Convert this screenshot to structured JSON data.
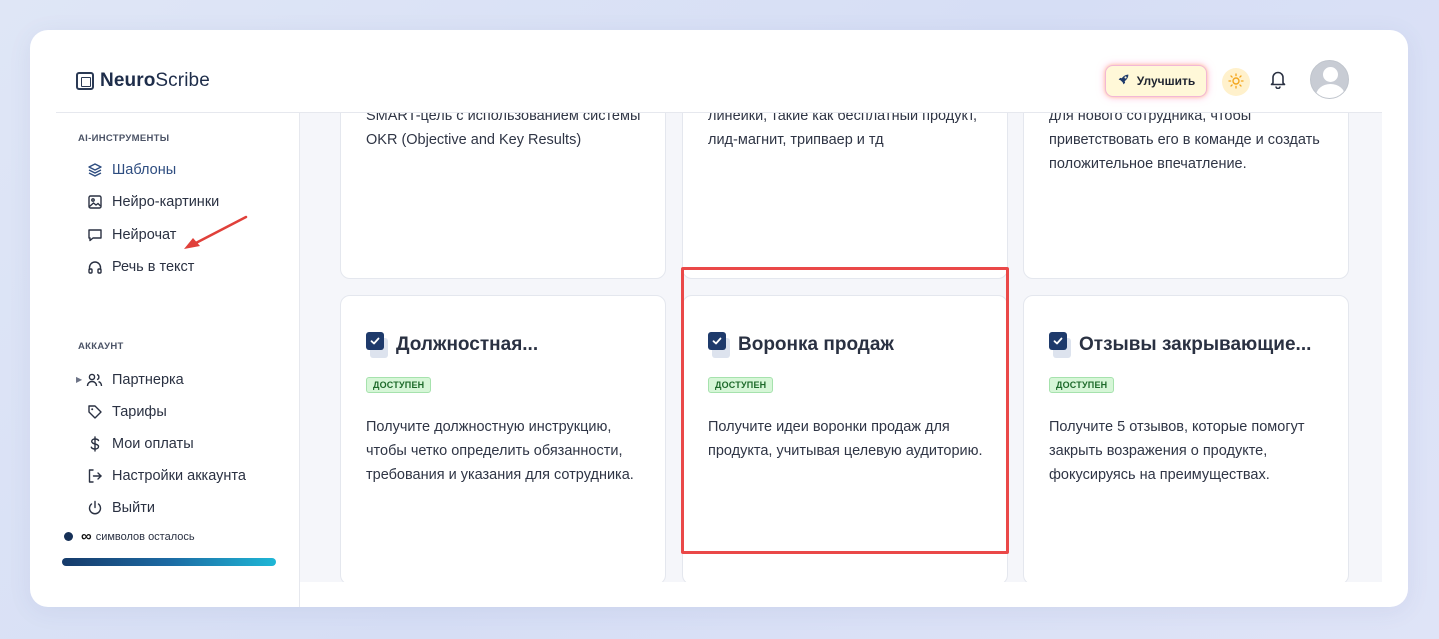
{
  "app": {
    "logo_bold": "Neuro",
    "logo_rest": "Scribe"
  },
  "header": {
    "upgrade_label": "Улучшить",
    "icons": [
      "rocket-icon",
      "sun-icon",
      "bell-icon",
      "avatar"
    ]
  },
  "sidebar": {
    "section_tools": "AI-ИНСТРУМЕНТЫ",
    "tools": [
      {
        "label": "Шаблоны",
        "icon": "layers-icon",
        "active": true
      },
      {
        "label": "Нейро-картинки",
        "icon": "image-icon"
      },
      {
        "label": "Нейрочат",
        "icon": "chat-icon"
      },
      {
        "label": "Речь в текст",
        "icon": "headphones-icon"
      }
    ],
    "section_account": "АККАУНТ",
    "account": [
      {
        "label": "Партнерка",
        "icon": "users-icon"
      },
      {
        "label": "Тарифы",
        "icon": "tag-icon"
      },
      {
        "label": "Мои оплаты",
        "icon": "dollar-icon"
      },
      {
        "label": "Настройки аккаунта",
        "icon": "login-icon"
      },
      {
        "label": "Выйти",
        "icon": "power-icon"
      }
    ],
    "symbols_value": "∞",
    "symbols_label": "символов осталось",
    "symbols_progress": 1.0
  },
  "cards_top": [
    {
      "desc": "SMART-цель с использованием системы OKR (Objective and Key Results)"
    },
    {
      "desc": "линейки, такие как бесплатный продукт, лид-магнит, трипваер и тд"
    },
    {
      "desc": "для нового сотрудника, чтобы приветствовать его в команде и создать положительное впечатление."
    }
  ],
  "cards": [
    {
      "title": "Должностная...",
      "badge": "ДОСТУПЕН",
      "desc": "Получите должностную инструкцию, чтобы четко определить обязанности, требования и указания для сотрудника."
    },
    {
      "title": "Воронка продаж",
      "badge": "ДОСТУПЕН",
      "desc": "Получите идеи воронки продаж для продукта, учитывая целевую аудиторию."
    },
    {
      "title": "Отзывы закрывающие...",
      "badge": "ДОСТУПЕН",
      "desc": "Получите 5 отзывов, которые помогут закрыть возражения о продукте, фокусируясь на преимуществах."
    }
  ],
  "colors": {
    "accent": "#1e3a6b",
    "highlight": "#ea4848",
    "badge_bg": "#d6f6d7",
    "badge_text": "#1d6a2a"
  }
}
